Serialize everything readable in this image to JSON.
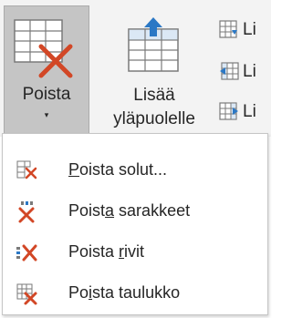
{
  "ribbon": {
    "delete_button": {
      "label": "Poista",
      "caret": "▾",
      "icon": "delete-table-icon"
    },
    "insert_above_button": {
      "label_line1": "Lisää",
      "label_line2": "yläpuolelle",
      "icon": "insert-row-above-icon"
    },
    "small_buttons": [
      {
        "label": "Li",
        "icon": "insert-row-below-icon"
      },
      {
        "label": "Li",
        "icon": "insert-column-left-icon"
      },
      {
        "label": "Li",
        "icon": "insert-column-right-icon"
      }
    ]
  },
  "menu": {
    "items": [
      {
        "pre": "",
        "accel": "P",
        "post": "oista solut...",
        "icon": "delete-cells-icon"
      },
      {
        "pre": "Poist",
        "accel": "a",
        "post": " sarakkeet",
        "icon": "delete-columns-icon"
      },
      {
        "pre": "Poista ",
        "accel": "r",
        "post": "ivit",
        "icon": "delete-rows-icon"
      },
      {
        "pre": "Po",
        "accel": "i",
        "post": "sta taulukko",
        "icon": "delete-table-icon"
      }
    ]
  },
  "colors": {
    "accent_red": "#d24726",
    "accent_blue": "#2b78c5",
    "pressed_bg": "#c5c5c5",
    "ribbon_bg": "#f3f3f3"
  }
}
